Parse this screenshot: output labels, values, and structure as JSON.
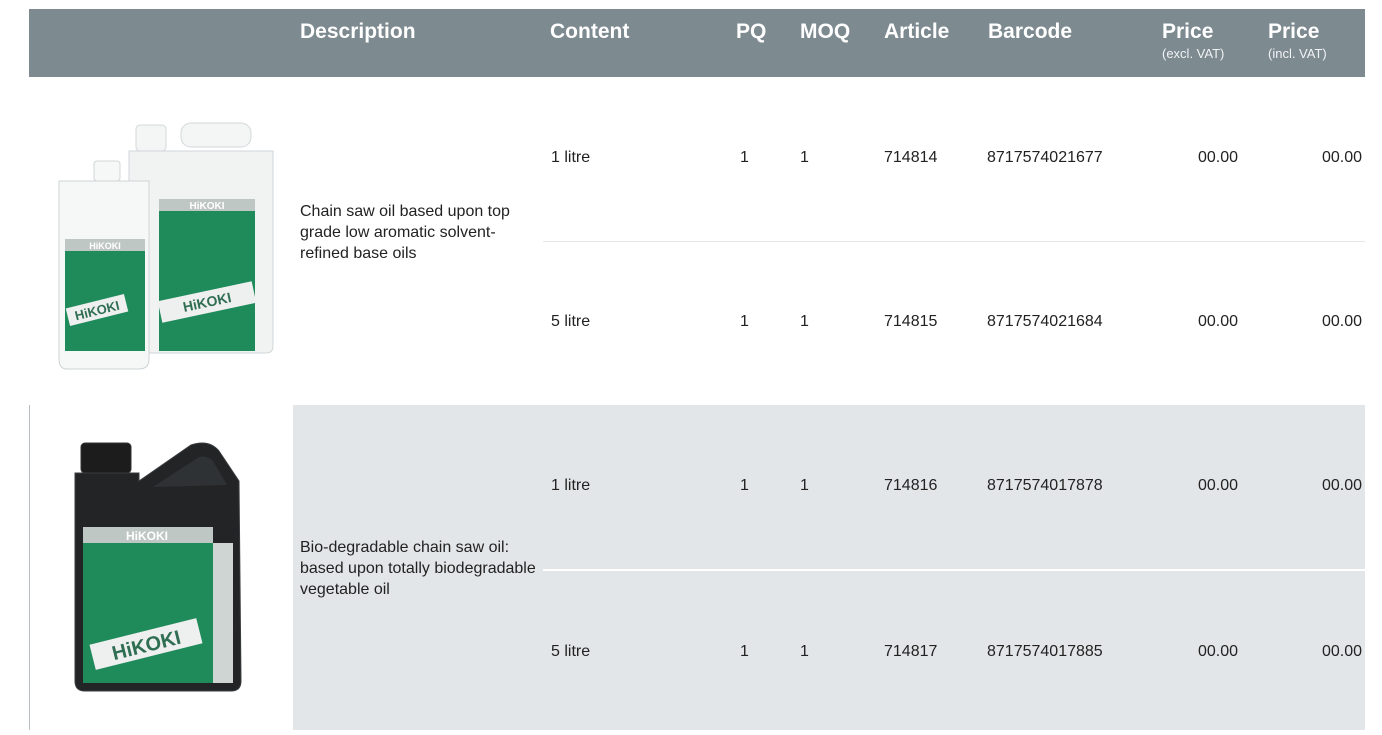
{
  "headers": {
    "description": "Description",
    "content": "Content",
    "pq": "PQ",
    "moq": "MOQ",
    "article": "Article",
    "barcode": "Barcode",
    "price_excl": "Price",
    "price_excl_sub": "(excl. VAT)",
    "price_incl": "Price",
    "price_incl_sub": "(incl. VAT)"
  },
  "products": [
    {
      "image": "white-oil-bottles-icon",
      "brand": "HiKOKI",
      "description": "Chain saw oil based upon top grade low aromatic solvent-refined base oils",
      "rows": [
        {
          "content": "1 litre",
          "pq": "1",
          "moq": "1",
          "article": "714814",
          "barcode": "8717574021677",
          "price_excl": "00.00",
          "price_incl": "00.00"
        },
        {
          "content": "5 litre",
          "pq": "1",
          "moq": "1",
          "article": "714815",
          "barcode": "8717574021684",
          "price_excl": "00.00",
          "price_incl": "00.00"
        }
      ]
    },
    {
      "image": "black-oil-bottle-icon",
      "brand": "HiKOKI",
      "description": "Bio-degradable chain saw oil: based upon totally biodegradable vegetable oil",
      "rows": [
        {
          "content": "1 litre",
          "pq": "1",
          "moq": "1",
          "article": "714816",
          "barcode": "8717574017878",
          "price_excl": "00.00",
          "price_incl": "00.00"
        },
        {
          "content": "5 litre",
          "pq": "1",
          "moq": "1",
          "article": "714817",
          "barcode": "8717574017885",
          "price_excl": "00.00",
          "price_incl": "00.00"
        }
      ]
    }
  ],
  "colors": {
    "header_bg": "#7d8a90",
    "shade_bg": "#e3e6e8",
    "label_green": "#1f8a5a"
  }
}
